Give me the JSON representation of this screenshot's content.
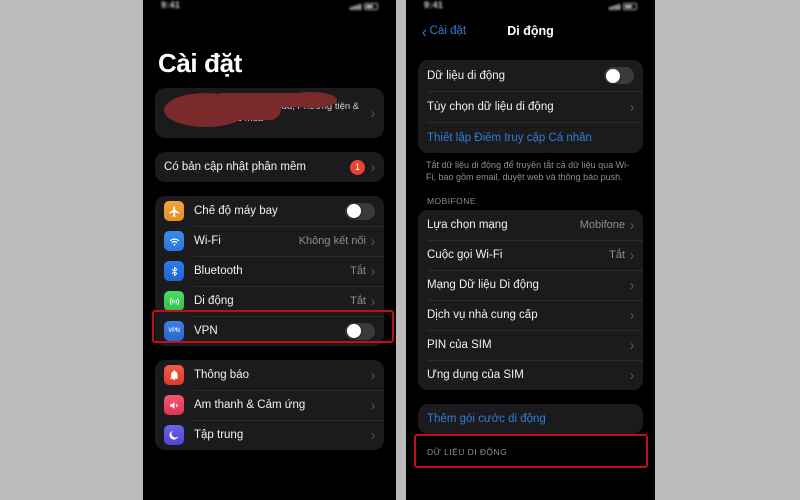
{
  "background_color": "#bbbbbb",
  "highlight_color": "#c20f15",
  "left_phone": {
    "status_bar": {
      "time": "9:41",
      "signal_icon": "signal-bars-icon",
      "battery_icon": "battery-icon"
    },
    "page_title": "Cài đặt",
    "apple_id": {
      "subtitle": "ID Apple, iCloud, Phương tiện & Mục mua",
      "redaction_color": "#7a2a2a",
      "chevron": "›"
    },
    "software_update": {
      "label": "Có bản cập nhật phần mềm",
      "badge": "1",
      "badge_color": "#e8442f",
      "chevron": "›"
    },
    "connectivity_rows": [
      {
        "label": "Chế độ máy bay",
        "icon": "airplane-icon",
        "icon_class": "ic-airplane",
        "control": "toggle",
        "value": ""
      },
      {
        "label": "Wi-Fi",
        "icon": "wifi-icon",
        "icon_class": "ic-wifi",
        "control": "value",
        "value": "Không kết nối"
      },
      {
        "label": "Bluetooth",
        "icon": "bluetooth-icon",
        "icon_class": "ic-bluetooth",
        "control": "value",
        "value": "Tắt"
      },
      {
        "label": "Di động",
        "icon": "cellular-icon",
        "icon_class": "ic-cellular",
        "control": "value",
        "value": "Tắt"
      },
      {
        "label": "VPN",
        "icon": "vpn-icon",
        "icon_class": "ic-vpn",
        "control": "toggle",
        "value": ""
      }
    ],
    "notification_rows": [
      {
        "label": "Thông báo",
        "icon": "bell-icon",
        "icon_class": "ic-bell"
      },
      {
        "label": "Âm thanh & Cảm ứng",
        "icon": "sound-icon",
        "icon_class": "ic-sound"
      },
      {
        "label": "Tập trung",
        "icon": "focus-moon-icon",
        "icon_class": "ic-focus"
      }
    ],
    "chevron": "›"
  },
  "right_phone": {
    "status_bar": {
      "time": "9:41",
      "signal_icon": "signal-bars-icon",
      "battery_icon": "battery-icon"
    },
    "nav": {
      "back_label": "Cài đặt",
      "back_icon": "chevron-left-icon",
      "title": "Di động"
    },
    "cellular_group": [
      {
        "label": "Dữ liệu di động",
        "control": "toggle",
        "value": "",
        "style": "normal"
      },
      {
        "label": "Tùy chọn dữ liệu di động",
        "control": "chevron",
        "value": "",
        "style": "normal"
      },
      {
        "label": "Thiết lập Điểm truy cập Cá nhân",
        "control": "none",
        "value": "",
        "style": "link"
      }
    ],
    "cellular_footer": "Tắt dữ liệu di động để truyền tắt cả dữ liệu qua Wi-Fi, bao gồm email, duyệt web và thông báo push.",
    "carrier_header": "MOBIFONE",
    "carrier_rows": [
      {
        "label": "Lựa chọn mạng",
        "value": "Mobifone"
      },
      {
        "label": "Cuộc gọi Wi-Fi",
        "value": "Tắt"
      },
      {
        "label": "Mạng Dữ liệu Di động",
        "value": ""
      },
      {
        "label": "Dịch vụ nhà cung cấp",
        "value": ""
      },
      {
        "label": "PIN của SIM",
        "value": ""
      },
      {
        "label": "Ứng dụng của SIM",
        "value": ""
      }
    ],
    "add_plan": {
      "label": "Thêm gói cước di động",
      "style": "link"
    },
    "data_header": "DỮ LIỆU DI ĐỘNG",
    "chevron": "›"
  }
}
